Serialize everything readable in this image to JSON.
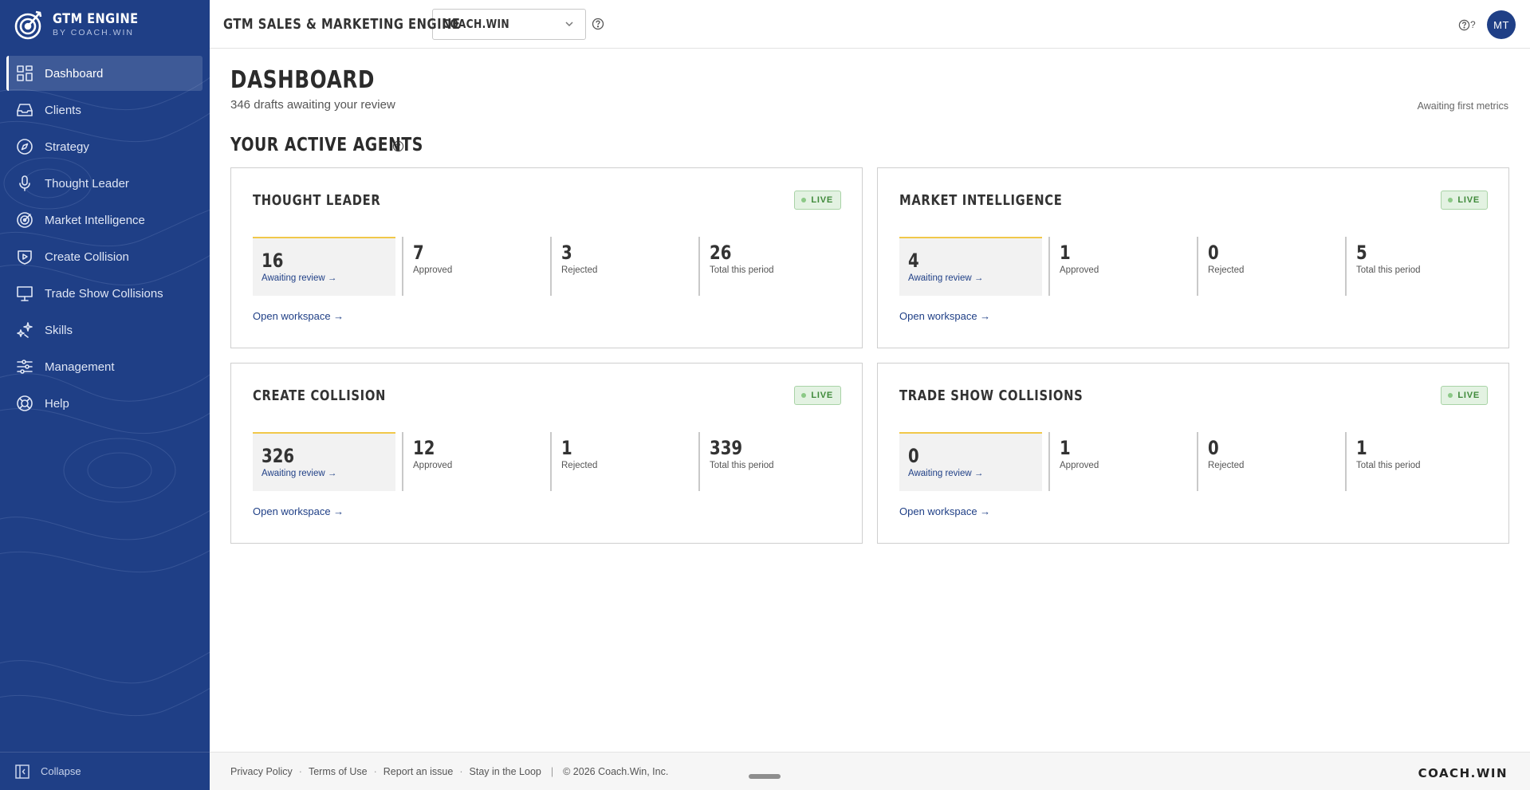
{
  "brand": {
    "title": "GTM ENGINE",
    "subtitle": "BY COACH.WIN",
    "logo_icon": "target-arrow-icon"
  },
  "sidebar": {
    "items": [
      {
        "label": "Dashboard",
        "icon": "dashboard-grid-icon",
        "active": true
      },
      {
        "label": "Clients",
        "icon": "inbox-icon",
        "active": false
      },
      {
        "label": "Strategy",
        "icon": "compass-icon",
        "active": false
      },
      {
        "label": "Thought Leader",
        "icon": "microphone-icon",
        "active": false
      },
      {
        "label": "Market Intelligence",
        "icon": "radar-icon",
        "active": false
      },
      {
        "label": "Create Collision",
        "icon": "shield-play-icon",
        "active": false
      },
      {
        "label": "Trade Show Collisions",
        "icon": "monitor-icon",
        "active": false
      },
      {
        "label": "Skills",
        "icon": "sparkles-icon",
        "active": false
      },
      {
        "label": "Management",
        "icon": "sliders-icon",
        "active": false
      },
      {
        "label": "Help",
        "icon": "lifebuoy-icon",
        "active": false
      }
    ],
    "collapse_label": "Collapse"
  },
  "header": {
    "title": "GTM SALES & MARKETING ENGINE",
    "client_select": "COACH.WIN",
    "help_label": "?",
    "avatar_initials": "MT"
  },
  "main": {
    "title": "DASHBOARD",
    "subtitle": "346 drafts awaiting your review",
    "metrics_note": "Awaiting first metrics",
    "section_title": "YOUR ACTIVE AGENTS",
    "agents": [
      {
        "name": "THOUGHT LEADER",
        "status": "LIVE",
        "awaiting": "16",
        "awaiting_label": "Awaiting review →",
        "approved": "7",
        "approved_label": "Approved",
        "rejected": "3",
        "rejected_label": "Rejected",
        "total": "26",
        "total_label": "Total this period",
        "link": "Open workspace →"
      },
      {
        "name": "MARKET INTELLIGENCE",
        "status": "LIVE",
        "awaiting": "4",
        "awaiting_label": "Awaiting review →",
        "approved": "1",
        "approved_label": "Approved",
        "rejected": "0",
        "rejected_label": "Rejected",
        "total": "5",
        "total_label": "Total this period",
        "link": "Open workspace →"
      },
      {
        "name": "CREATE COLLISION",
        "status": "LIVE",
        "awaiting": "326",
        "awaiting_label": "Awaiting review →",
        "approved": "12",
        "approved_label": "Approved",
        "rejected": "1",
        "rejected_label": "Rejected",
        "total": "339",
        "total_label": "Total this period",
        "link": "Open workspace →"
      },
      {
        "name": "TRADE SHOW COLLISIONS",
        "status": "LIVE",
        "awaiting": "0",
        "awaiting_label": "Awaiting review →",
        "approved": "1",
        "approved_label": "Approved",
        "rejected": "0",
        "rejected_label": "Rejected",
        "total": "1",
        "total_label": "Total this period",
        "link": "Open workspace →"
      }
    ]
  },
  "footer": {
    "links": [
      "Privacy Policy",
      "Terms of Use",
      "Report an issue",
      "Stay in the Loop"
    ],
    "copyright": "© 2026 Coach.Win, Inc.",
    "brand": "COACH.WIN"
  },
  "colors": {
    "sidebar": "#1f3f86",
    "accent": "#f1c84a",
    "live_green": "#3f8a3a"
  }
}
